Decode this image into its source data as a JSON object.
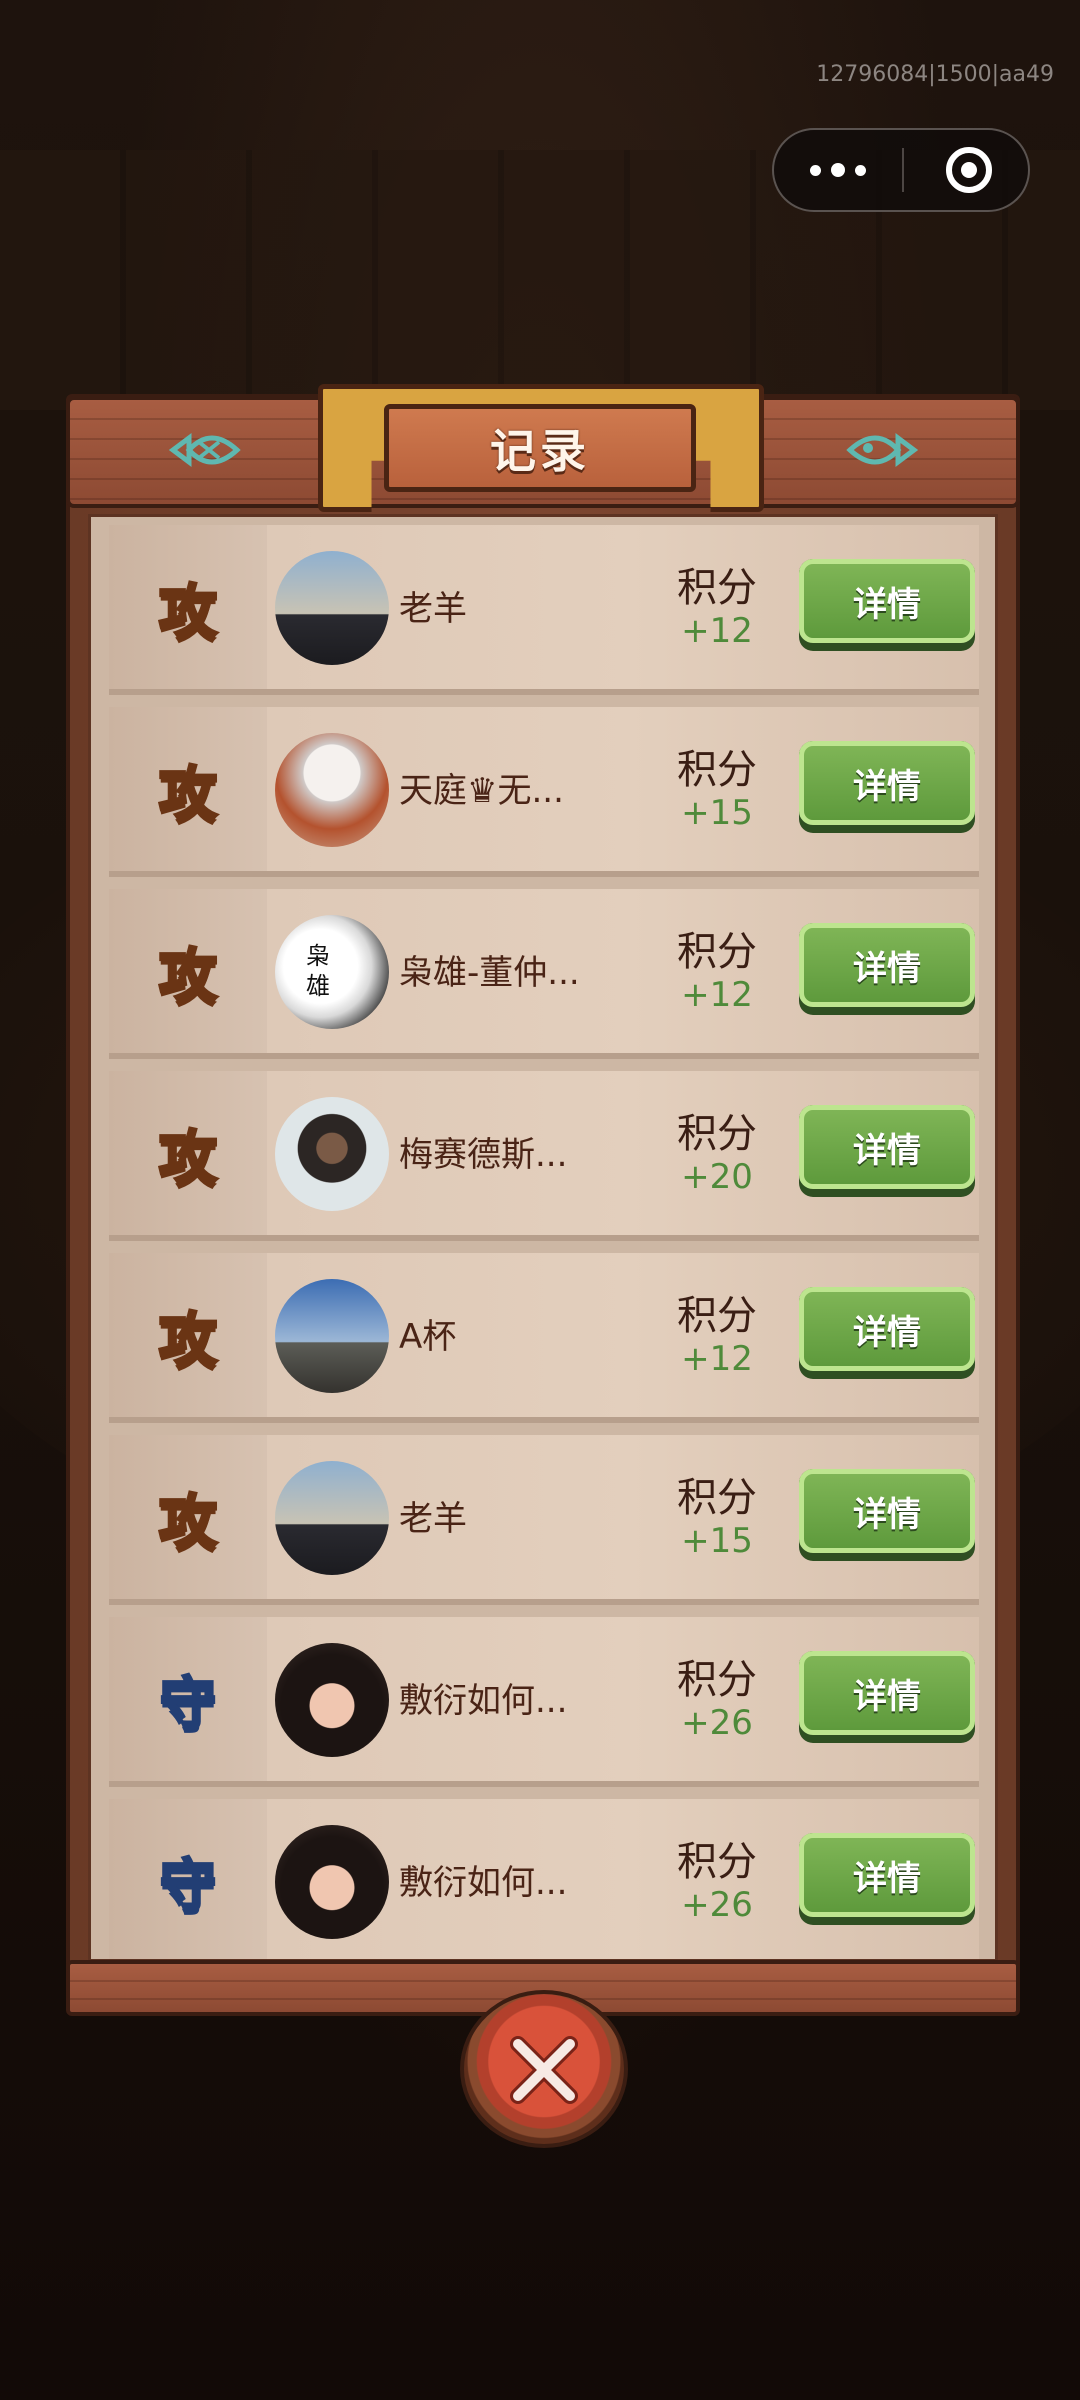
{
  "app": {
    "build_id": "12796084|1500|aa49"
  },
  "capsule": {
    "more_icon": "more-dots-icon",
    "close_icon": "target-close-icon"
  },
  "panel": {
    "title": "记录"
  },
  "records": [
    {
      "type": "攻",
      "kind": "attack",
      "name": "老羊",
      "score_label": "积分",
      "score": "+12",
      "button": "详情",
      "avatar": "av-sky"
    },
    {
      "type": "攻",
      "kind": "attack",
      "name": "天庭♛无...",
      "score_label": "积分",
      "score": "+15",
      "button": "详情",
      "avatar": "av-white"
    },
    {
      "type": "攻",
      "kind": "attack",
      "name": "枭雄-董仲...",
      "score_label": "积分",
      "score": "+12",
      "button": "详情",
      "avatar": "av-ink"
    },
    {
      "type": "攻",
      "kind": "attack",
      "name": "梅赛德斯...",
      "score_label": "积分",
      "score": "+20",
      "button": "详情",
      "avatar": "av-boy"
    },
    {
      "type": "攻",
      "kind": "attack",
      "name": "A杯",
      "score_label": "积分",
      "score": "+12",
      "button": "详情",
      "avatar": "av-blue"
    },
    {
      "type": "攻",
      "kind": "attack",
      "name": "老羊",
      "score_label": "积分",
      "score": "+15",
      "button": "详情",
      "avatar": "av-sky"
    },
    {
      "type": "守",
      "kind": "defense",
      "name": "敷衍如何...",
      "score_label": "积分",
      "score": "+26",
      "button": "详情",
      "avatar": "av-dark"
    },
    {
      "type": "守",
      "kind": "defense",
      "name": "敷衍如何...",
      "score_label": "积分",
      "score": "+26",
      "button": "详情",
      "avatar": "av-dark"
    }
  ],
  "avatar_ink_text": "枭雄",
  "colors": {
    "attack": "#f4c64a",
    "defense": "#6aa9e8",
    "score": "#4f8a3a",
    "button": "#5e9a3c",
    "close": "#d9523a"
  }
}
